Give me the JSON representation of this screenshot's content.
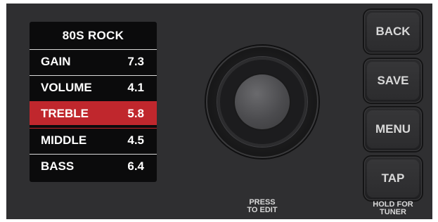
{
  "display": {
    "preset_name": "80S ROCK",
    "parameters": [
      {
        "name": "GAIN",
        "value": "7.3",
        "selected": false
      },
      {
        "name": "VOLUME",
        "value": "4.1",
        "selected": false
      },
      {
        "name": "TREBLE",
        "value": "5.8",
        "selected": true
      },
      {
        "name": "MIDDLE",
        "value": "4.5",
        "selected": false
      },
      {
        "name": "BASS",
        "value": "6.4",
        "selected": false
      }
    ],
    "highlight_color": "#c0272d"
  },
  "encoder": {
    "label_line1": "PRESS",
    "label_line2": "TO EDIT"
  },
  "buttons": {
    "back": "BACK",
    "save": "SAVE",
    "menu": "MENU",
    "tap": "TAP",
    "tap_hint_line1": "HOLD FOR",
    "tap_hint_line2": "TUNER"
  },
  "colors": {
    "panel": "#2f2f31",
    "lcd_background": "#0b0b0c",
    "text": "#ffffff",
    "button_label": "#d8d8d8"
  }
}
